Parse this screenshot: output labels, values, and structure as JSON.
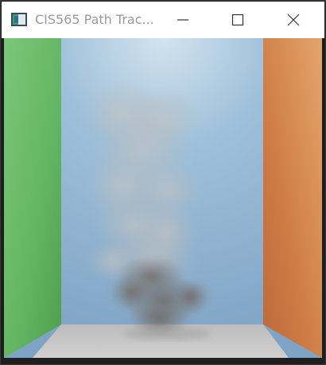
{
  "window": {
    "title": "CIS565 Path Trac...",
    "icon": "app-window-icon",
    "controls": [
      "minimize-icon",
      "maximize-icon",
      "close-icon"
    ]
  },
  "scene": {
    "description_colors": {
      "left_wall": "#6fc36f",
      "right_wall": "#d7874c",
      "back_wall": "#9fbfd8",
      "floor": "#c9c9c9",
      "smoke": "#8f8a86"
    }
  }
}
